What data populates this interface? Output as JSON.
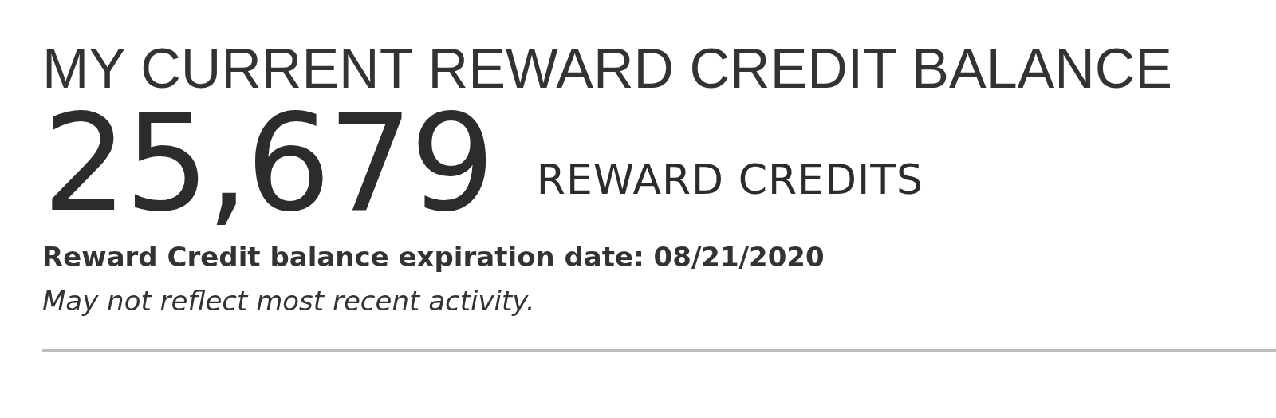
{
  "heading": "MY CURRENT REWARD CREDIT BALANCE",
  "balance": {
    "amount": "25,679",
    "unit": "REWARD CREDITS"
  },
  "expiration": "Reward Credit balance expiration date: 08/21/2020",
  "note": "May not reflect most recent activity."
}
